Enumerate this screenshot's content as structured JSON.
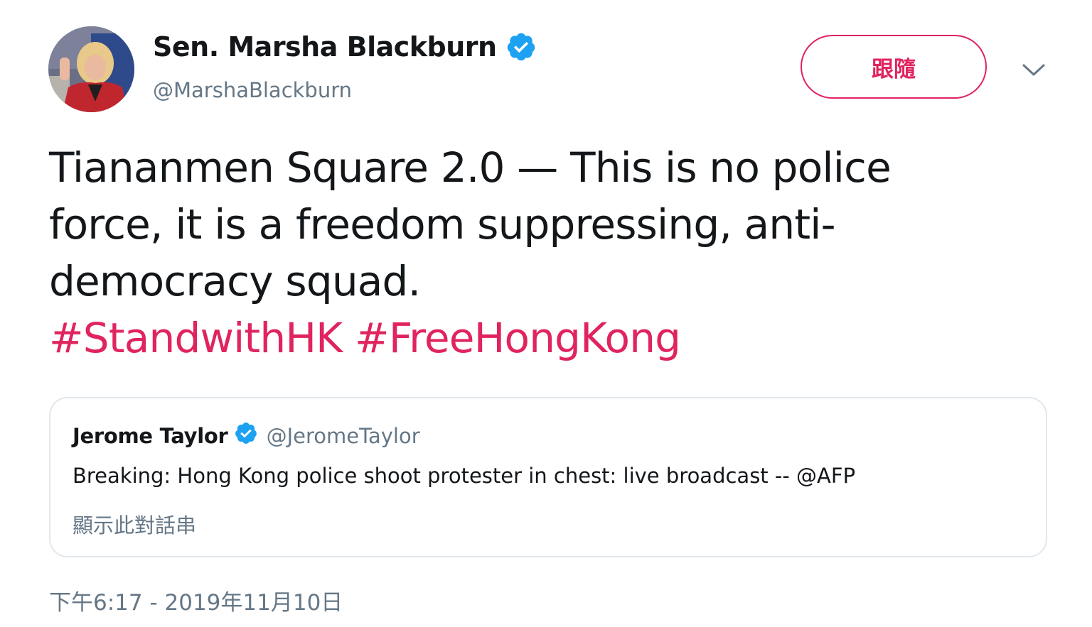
{
  "tweet": {
    "author": {
      "display_name": "Sen. Marsha Blackburn",
      "handle": "@MarshaBlackburn",
      "verified": true
    },
    "follow_button_label": "跟隨",
    "text_lines": [
      "Tiananmen Square 2.0 — This is no police",
      "force, it is a freedom suppressing, anti-",
      "democracy squad."
    ],
    "hashtags": [
      "#StandwithHK",
      "#FreeHongKong"
    ],
    "timestamp": "下午6:17 - 2019年11月10日"
  },
  "quoted_tweet": {
    "author_name": "Jerome Taylor",
    "author_handle": "@JeromeTaylor",
    "verified": true,
    "text": "Breaking: Hong Kong police shoot protester in chest: live broadcast -- @AFP",
    "show_thread_label": "顯示此對話串"
  },
  "colors": {
    "accent": "#e0245e",
    "verified_blue": "#1da1f2",
    "secondary_text": "#657786",
    "primary_text": "#14171a",
    "card_border": "#e1e8ed"
  },
  "icons": {
    "verified": "verified-badge-icon",
    "caret": "chevron-down-icon"
  }
}
